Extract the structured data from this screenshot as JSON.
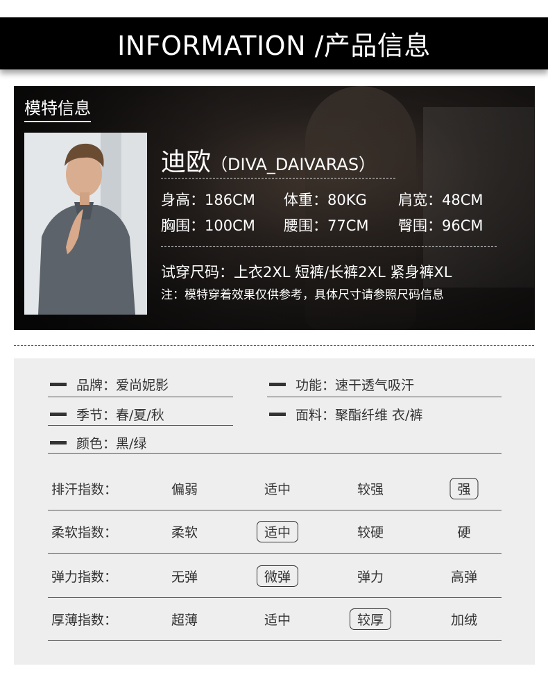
{
  "header": {
    "title": "INFORMATION /产品信息"
  },
  "model": {
    "section_title": "模特信息",
    "name": "迪欧",
    "name_en": "（DIVA_DAIVARAS）",
    "height": "身高：186CM",
    "weight": "体重：80KG",
    "shoulder": "肩宽：48CM",
    "chest": "胸围：100CM",
    "waist": "腰围：77CM",
    "hip": "臀围：96CM",
    "try_on": "试穿尺码：上衣2XL   短裤/长裤2XL   紧身裤XL",
    "note": "注：模特穿着效果仅供参考，具体尺寸请参照尺码信息"
  },
  "attributes": {
    "brand": "品牌：爱尚妮影",
    "function": "功能：速干透气吸汗",
    "season": "季节：春/夏/秋",
    "fabric": "面料：聚酯纤维 衣/裤",
    "color": "颜色：黑/绿"
  },
  "indices": [
    {
      "label": "排汗指数：",
      "options": [
        "偏弱",
        "适中",
        "较强",
        "强"
      ],
      "selected": 3
    },
    {
      "label": "柔软指数：",
      "options": [
        "柔软",
        "适中",
        "较硬",
        "硬"
      ],
      "selected": 1
    },
    {
      "label": "弹力指数：",
      "options": [
        "无弹",
        "微弹",
        "弹力",
        "高弹"
      ],
      "selected": 1
    },
    {
      "label": "厚薄指数：",
      "options": [
        "超薄",
        "适中",
        "较厚",
        "加绒"
      ],
      "selected": 2
    }
  ]
}
